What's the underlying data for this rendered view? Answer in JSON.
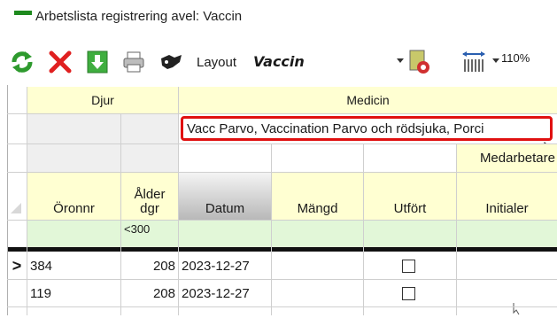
{
  "window": {
    "title": "Arbetslista registrering avel: Vaccin"
  },
  "toolbar": {
    "layout_label": "Layout",
    "layout_value": "Vaccin",
    "zoom": "110%",
    "icons": [
      "refresh-icon",
      "delete-icon",
      "download-icon",
      "print-icon",
      "settings-icon",
      "layout-save-icon",
      "column-width-icon"
    ]
  },
  "grid": {
    "group_headers": {
      "djur": "Djur",
      "medicin": "Medicin"
    },
    "medicine_name": "Vacc Parvo, Vaccination Parvo och rödsjuka, Porci",
    "medarbetare": "Medarbetare",
    "columns": {
      "oronnr": "Öronnr",
      "alder_line1": "Ålder",
      "alder_line2": "dgr",
      "datum": "Datum",
      "mangd": "Mängd",
      "utfort": "Utfört",
      "initialer": "Initialer"
    },
    "filter": {
      "alder": "<300"
    },
    "rows": [
      {
        "marker": ">",
        "oronnr": "384",
        "alder": "208",
        "datum": "2023-12-27",
        "mangd": "",
        "utfort": false,
        "initialer": ""
      },
      {
        "marker": "",
        "oronnr": "119",
        "alder": "208",
        "datum": "2023-12-27",
        "mangd": "",
        "utfort": false,
        "initialer": ""
      }
    ]
  },
  "colors": {
    "highlight_border": "#e01010",
    "header_yellow": "#ffffd2",
    "filter_green": "#e2f7d8"
  }
}
